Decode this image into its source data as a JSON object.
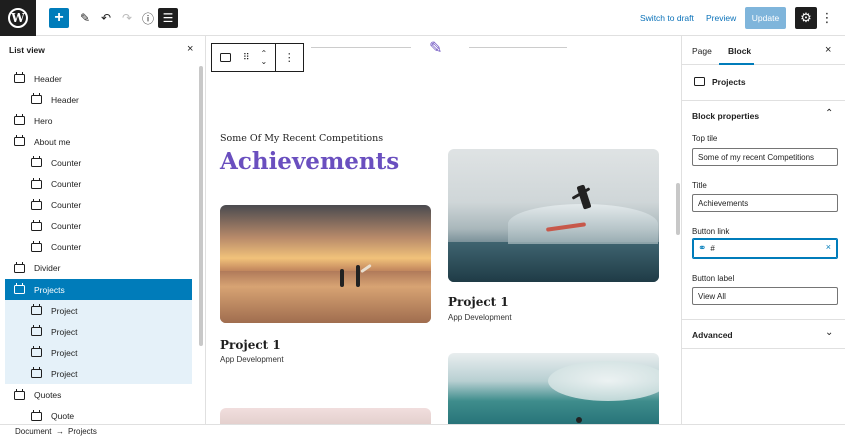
{
  "toolbar": {
    "logo_label": "W",
    "add_icon": "+",
    "edit_icon": "✎",
    "undo_icon": "↶",
    "redo_icon": "↷",
    "info_icon": "ⓘ",
    "listview_icon": "☰",
    "switch_to_draft": "Switch to draft",
    "preview": "Preview",
    "update": "Update",
    "settings_icon": "⚙",
    "more_icon": "⋮"
  },
  "listview": {
    "title": "List view",
    "close_icon": "×",
    "items": [
      {
        "label": "Header",
        "level": 0,
        "state": ""
      },
      {
        "label": "Header",
        "level": 1,
        "state": ""
      },
      {
        "label": "Hero",
        "level": 0,
        "state": ""
      },
      {
        "label": "About me",
        "level": 0,
        "state": ""
      },
      {
        "label": "Counter",
        "level": 1,
        "state": ""
      },
      {
        "label": "Counter",
        "level": 1,
        "state": ""
      },
      {
        "label": "Counter",
        "level": 1,
        "state": ""
      },
      {
        "label": "Counter",
        "level": 1,
        "state": ""
      },
      {
        "label": "Counter",
        "level": 1,
        "state": ""
      },
      {
        "label": "Divider",
        "level": 0,
        "state": ""
      },
      {
        "label": "Projects",
        "level": 0,
        "state": "selected"
      },
      {
        "label": "Project",
        "level": 1,
        "state": "child"
      },
      {
        "label": "Project",
        "level": 1,
        "state": "child"
      },
      {
        "label": "Project",
        "level": 1,
        "state": "child"
      },
      {
        "label": "Project",
        "level": 1,
        "state": "child"
      },
      {
        "label": "Quotes",
        "level": 0,
        "state": ""
      },
      {
        "label": "Quote",
        "level": 1,
        "state": ""
      }
    ]
  },
  "canvas": {
    "divider_icon": "✎",
    "top_title": "Some Of My Recent Competitions",
    "title": "Achievements",
    "projects": [
      {
        "name": "Project 1",
        "category": "App Development"
      },
      {
        "name": "Project 1",
        "category": "App Development"
      }
    ]
  },
  "sidebar": {
    "tab_page": "Page",
    "tab_block": "Block",
    "close_icon": "×",
    "block_name": "Projects",
    "block_properties": "Block properties",
    "collapse_icon": "⌃",
    "fields": {
      "top_title_label": "Top tile",
      "top_title_value": "Some of my recent Competitions",
      "title_label": "Title",
      "title_value": "Achievements",
      "button_link_label": "Button link",
      "button_link_value": "#",
      "button_label_label": "Button label",
      "button_label_value": "View All"
    },
    "advanced": "Advanced",
    "expand_icon": "⌄"
  },
  "footer": {
    "crumb_document": "Document",
    "separator": "→",
    "crumb_projects": "Projects"
  },
  "colors": {
    "accent": "#007cba",
    "heading": "#6a4fbf",
    "dark": "#1e1e1e"
  }
}
